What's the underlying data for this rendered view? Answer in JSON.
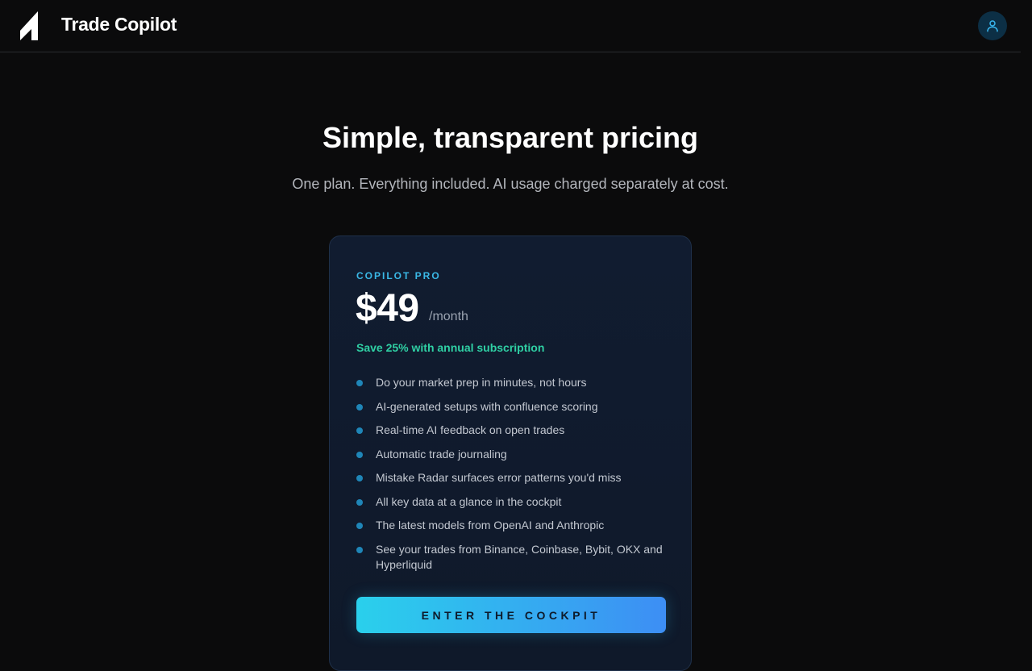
{
  "header": {
    "brand": "Trade Copilot",
    "logo_icon": "trade-copilot-logo-icon",
    "account_icon": "user-icon"
  },
  "hero": {
    "title": "Simple, transparent pricing",
    "subtitle": "One plan. Everything included. AI usage charged separately at cost."
  },
  "plan": {
    "name": "COPILOT PRO",
    "price": "$49",
    "period": "/month",
    "savings": "Save 25% with annual subscription",
    "features": [
      "Do your market prep in minutes, not hours",
      "AI-generated setups with confluence scoring",
      "Real-time AI feedback on open trades",
      "Automatic trade journaling",
      "Mistake Radar surfaces error patterns you'd miss",
      "All key data at a glance in the cockpit",
      "The latest models from OpenAI and Anthropic",
      "See your trades from Binance, Coinbase, Bybit, OKX and Hyperliquid"
    ],
    "cta_label": "ENTER THE COCKPIT"
  },
  "colors": {
    "background": "#0b0b0c",
    "accent": "#3ab8e6",
    "savings": "#2fd0a4",
    "card": "#111c30"
  }
}
